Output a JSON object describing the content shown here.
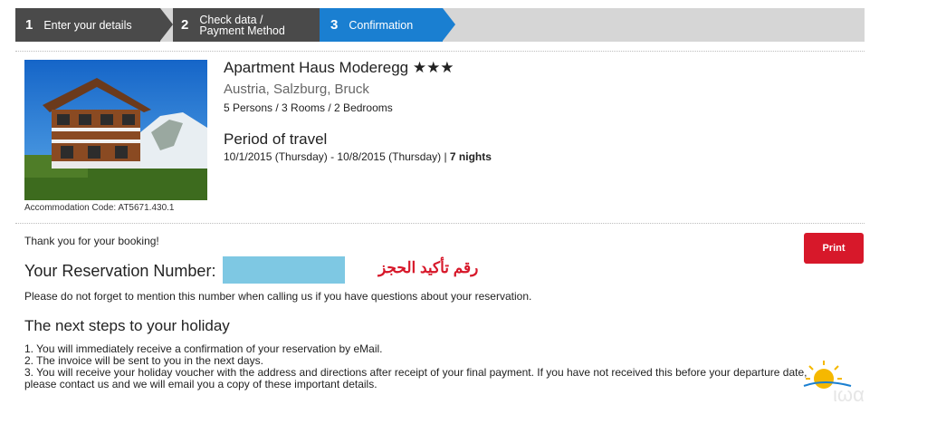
{
  "steps": [
    {
      "num": "1",
      "label": "Enter your details"
    },
    {
      "num": "2",
      "label": "Check data / Payment Method"
    },
    {
      "num": "3",
      "label": "Confirmation"
    }
  ],
  "accommodation": {
    "name": "Apartment Haus Moderegg ★★★",
    "location": "Austria, Salzburg, Bruck",
    "details": "5 Persons / 3 Rooms / 2 Bedrooms",
    "code": "Accommodation Code: AT5671.430.1",
    "period_title": "Period of travel",
    "period_dates": "10/1/2015 (Thursday) - 10/8/2015 (Thursday) | ",
    "nights": "7 nights"
  },
  "confirmation": {
    "thanks": "Thank you for your booking!",
    "print_label": "Print",
    "reservation_label": "Your Reservation Number:",
    "annotation_ar": "رقم تأكيد الحجز",
    "note": "Please do not forget to mention this number when calling us if you have questions about your reservation."
  },
  "next_steps": {
    "title": "The next steps to your holiday",
    "items": [
      "1. You will immediately receive a confirmation of your reservation by eMail.",
      "2. The invoice will be sent to you in the next days.",
      "3. You will receive your holiday voucher with the address and directions after receipt of your final payment. If you have not received this before your departure date, please contact us and we will email you a copy of these important details."
    ]
  },
  "colors": {
    "active_step": "#1a7fd1",
    "inactive_step": "#4a4a4a",
    "print_button": "#d7182a",
    "redaction": "#7ec8e3"
  }
}
